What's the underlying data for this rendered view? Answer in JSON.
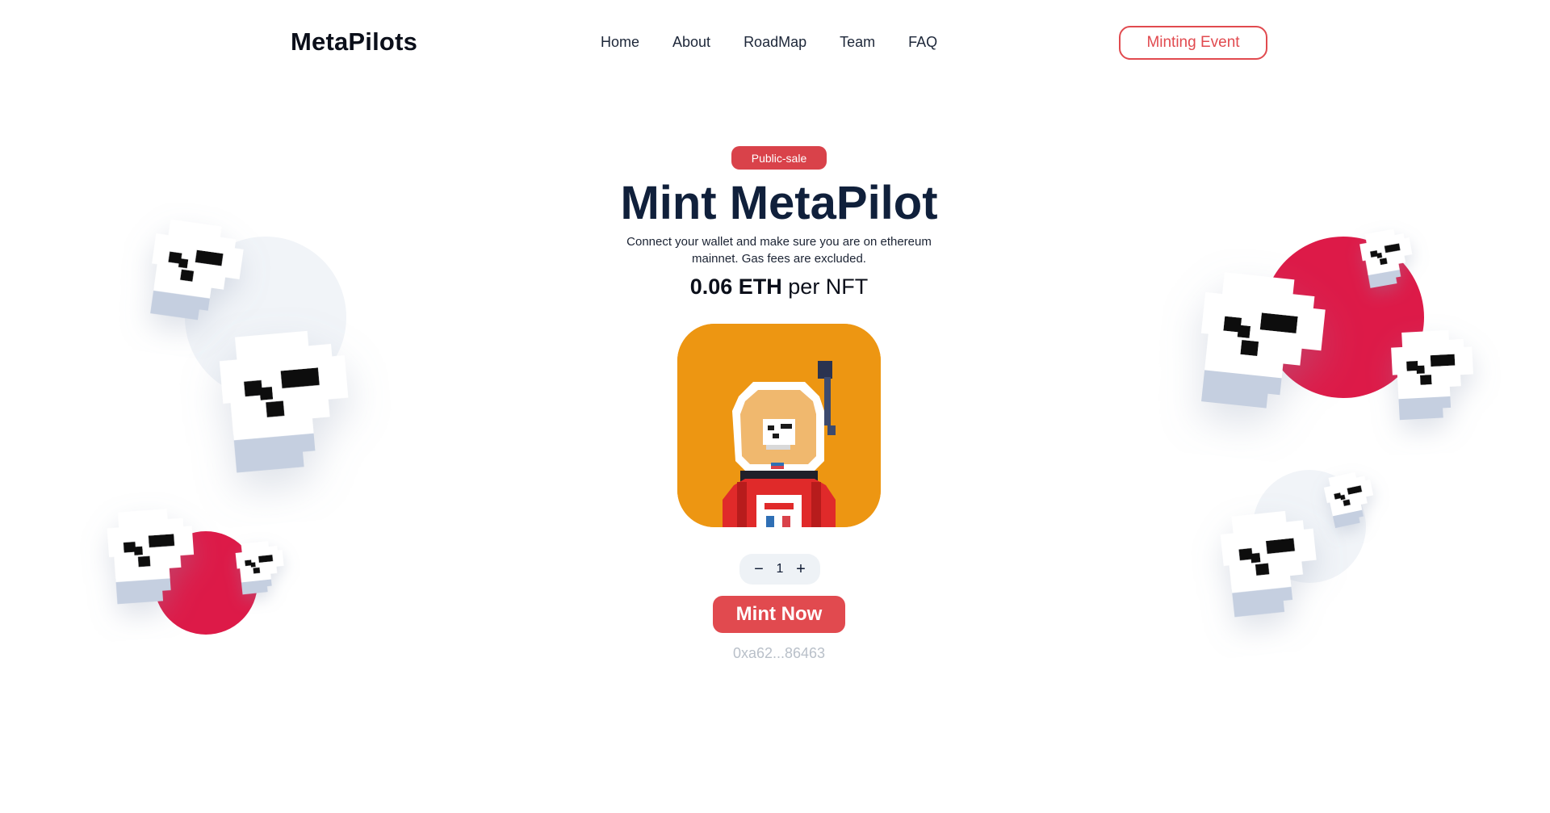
{
  "nav": {
    "logo": "MetaPilots",
    "links": [
      "Home",
      "About",
      "RoadMap",
      "Team",
      "FAQ"
    ],
    "cta": "Minting Event"
  },
  "hero": {
    "badge": "Public-sale",
    "title": "Mint MetaPilot",
    "subtitle_line1": "Connect your wallet and make sure you are on ethereum",
    "subtitle_line2": "mainnet. Gas fees are excluded.",
    "price_amount": "0.06 ETH",
    "price_suffix": "per NFT"
  },
  "mint": {
    "decrement": "−",
    "quantity": "1",
    "increment": "+",
    "button": "Mint Now",
    "wallet_address": "0xa62...86463"
  },
  "colors": {
    "accent": "#e14a4f",
    "badge": "#d9424a",
    "nft_bg": "#ed9612",
    "deco_red": "#dd1a48",
    "deco_grey": "#f1f4f8"
  }
}
